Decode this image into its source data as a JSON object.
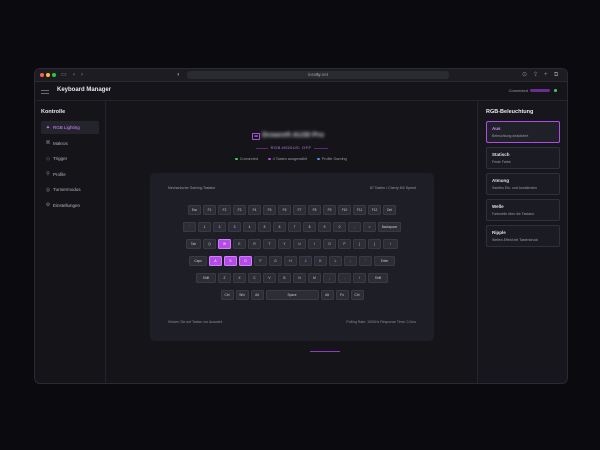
{
  "browser": {
    "url": "inssny.net"
  },
  "app": {
    "title": "Keyboard Manager",
    "status": "Connected"
  },
  "sidebar": {
    "title": "Kontrolle",
    "items": [
      {
        "label": "RGB Lighting",
        "icon": "sparkle-icon",
        "active": true
      },
      {
        "label": "Makros",
        "icon": "command-icon",
        "active": false
      },
      {
        "label": "Trigger",
        "icon": "diamond-icon",
        "active": false
      },
      {
        "label": "Profile",
        "icon": "user-icon",
        "active": false
      },
      {
        "label": "Turniermodus",
        "icon": "gamepad-icon",
        "active": false
      },
      {
        "label": "Einstellungen",
        "icon": "gear-icon",
        "active": false
      }
    ]
  },
  "device": {
    "name": "Drowreft AU30 Pro",
    "mode": "RGB-MODUS: OFF"
  },
  "stats": [
    {
      "label": "Connected",
      "color": "#3ad06a"
    },
    {
      "label": "4 Tasten ausgewählt",
      "color": "#b04ce6"
    },
    {
      "label": "Profile Gaming",
      "color": "#4a8cf0"
    }
  ],
  "keyboard": {
    "label_left": "Mechanische Gaming-Tastatur",
    "label_right": "87 Tasten • Cherry MX Speed",
    "footer_left": "Klicken Sie auf Tasten zur Auswahl",
    "footer_right": "Polling Rate: 1000Hz     Response Time: 0.2ms",
    "selected": [
      "W",
      "A",
      "S",
      "D"
    ],
    "rows": [
      [
        "Esc",
        "F1",
        "F2",
        "F3",
        "F4",
        "F5",
        "F6",
        "F7",
        "F8",
        "F9",
        "F10",
        "F11",
        "F12",
        "Del"
      ],
      [
        "`",
        "1",
        "2",
        "3",
        "4",
        "5",
        "6",
        "7",
        "8",
        "9",
        "0",
        "-",
        "=",
        "Backspace"
      ],
      [
        "Tab",
        "Q",
        "W",
        "E",
        "R",
        "T",
        "Y",
        "U",
        "I",
        "O",
        "P",
        "[",
        "]",
        "\\"
      ],
      [
        "Caps",
        "A",
        "S",
        "D",
        "F",
        "G",
        "H",
        "J",
        "K",
        "L",
        ";",
        "'",
        "Enter"
      ],
      [
        "Shift",
        "Z",
        "X",
        "C",
        "V",
        "B",
        "N",
        "M",
        ",",
        ".",
        "/",
        "Shift"
      ],
      [
        "Ctrl",
        "Win",
        "Alt",
        "Space",
        "Alt",
        "Fn",
        "Ctrl"
      ]
    ]
  },
  "effects_panel": {
    "title": "RGB-Beleuchtung",
    "effects": [
      {
        "name": "Aus",
        "desc": "Beleuchtung deaktiviert",
        "active": true
      },
      {
        "name": "Statisch",
        "desc": "Feste Farbe",
        "active": false
      },
      {
        "name": "Atmung",
        "desc": "Sanftes Ein- und Ausblenden",
        "active": false
      },
      {
        "name": "Welle",
        "desc": "Farbwelle über die Tastatur",
        "active": false
      },
      {
        "name": "Ripple",
        "desc": "Wellen-Effekt bei Tastendruck",
        "active": false
      }
    ]
  },
  "colors": {
    "accent": "#b04ce6",
    "background": "#141419",
    "key": "#2d2d37"
  }
}
